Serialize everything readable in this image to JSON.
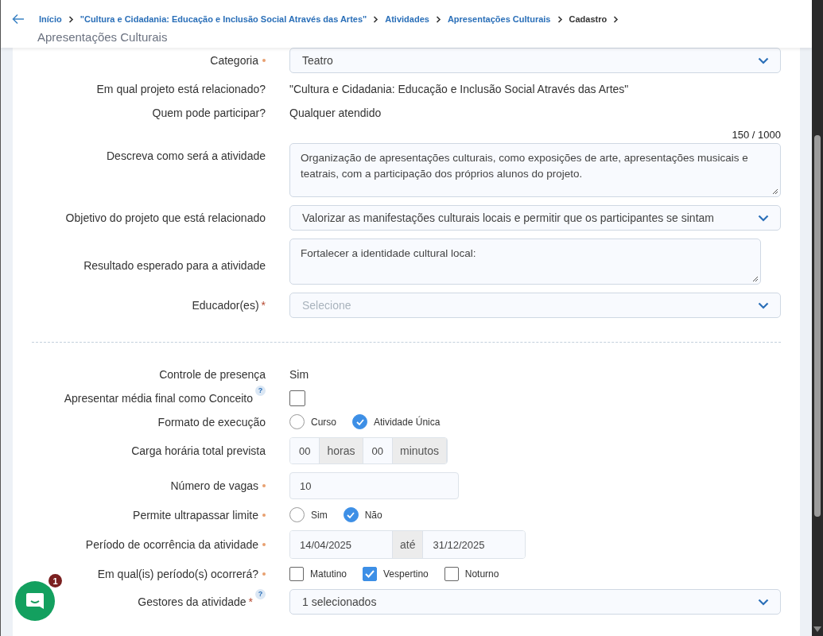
{
  "header": {
    "breadcrumb": [
      {
        "label": "Início",
        "kind": "link"
      },
      {
        "label": "\"Cultura e Cidadania: Educação e Inclusão Social Através das Artes\"",
        "kind": "link"
      },
      {
        "label": "Atividades",
        "kind": "link"
      },
      {
        "label": "Apresentações Culturais",
        "kind": "link"
      },
      {
        "label": "Cadastro",
        "kind": "current"
      }
    ],
    "title": "Apresentações Culturais"
  },
  "fields": [
    {
      "kind": "select",
      "label": "Categoria",
      "required": {
        "kind": "dot"
      },
      "value": "Teatro"
    },
    {
      "kind": "text",
      "label": "Em qual projeto está relacionado?",
      "value": "\"Cultura e Cidadania: Educação e Inclusão Social Através das Artes\""
    },
    {
      "kind": "text",
      "label": "Quem pode participar?",
      "value": "Qualquer atendido"
    },
    {
      "kind": "textarea",
      "label": "Descreva como será a atividade",
      "counter": "150 / 1000",
      "value": "Organização de apresentações culturais, como exposições de arte, apresentações musicais e teatrais, com a participação dos próprios alunos do projeto."
    },
    {
      "kind": "select",
      "label": "Objetivo do projeto que está relacionado",
      "value": "Valorizar as manifestações culturais locais e permitir que os participantes se sintam"
    },
    {
      "kind": "textarea",
      "label": "Resultado esperado para a atividade",
      "value": "Fortalecer a identidade cultural local:"
    },
    {
      "kind": "select",
      "label": "Educador(es)",
      "required": {
        "kind": "asterisk",
        "text": "*"
      },
      "placeholder": "Selecione"
    },
    {
      "kind": "divider"
    },
    {
      "kind": "text",
      "label": "Controle de presença",
      "value": "Sim"
    },
    {
      "kind": "checkbox",
      "label": "Apresentar média final como Conceito",
      "help": "?",
      "checked": false
    },
    {
      "kind": "radio",
      "label": "Formato de execução",
      "options": [
        {
          "label": "Curso",
          "selected": false
        },
        {
          "label": "Atividade Única",
          "selected": true
        }
      ]
    },
    {
      "kind": "group",
      "label": "Carga horária total prevista",
      "parts": [
        {
          "kind": "input",
          "value": "00"
        },
        {
          "kind": "addon",
          "text": "horas"
        },
        {
          "kind": "input",
          "value": "00"
        },
        {
          "kind": "addon",
          "text": "minutos"
        }
      ]
    },
    {
      "kind": "input",
      "label": "Número de vagas",
      "required": {
        "kind": "dot"
      },
      "value": "10"
    },
    {
      "kind": "radio",
      "label": "Permite ultrapassar limite",
      "required": {
        "kind": "dot"
      },
      "options": [
        {
          "label": "Sim",
          "selected": false
        },
        {
          "label": "Não",
          "selected": true
        }
      ]
    },
    {
      "kind": "group",
      "label": "Período de ocorrência da atividade",
      "required": {
        "kind": "dot"
      },
      "parts": [
        {
          "kind": "input",
          "value": "14/04/2025"
        },
        {
          "kind": "addon",
          "text": "até"
        },
        {
          "kind": "input",
          "value": "31/12/2025"
        }
      ]
    },
    {
      "kind": "checks",
      "label": "Em qual(is) período(s) ocorrerá?",
      "required": {
        "kind": "dot"
      },
      "options": [
        {
          "label": "Matutino",
          "checked": false
        },
        {
          "label": "Vespertino",
          "checked": true
        },
        {
          "label": "Noturno",
          "checked": false
        }
      ]
    },
    {
      "kind": "select",
      "label": "Gestores da atividade",
      "required": {
        "kind": "asterisk",
        "text": "*"
      },
      "help": "?",
      "value": "1 selecionados"
    }
  ],
  "chat": {
    "badge": "1"
  }
}
